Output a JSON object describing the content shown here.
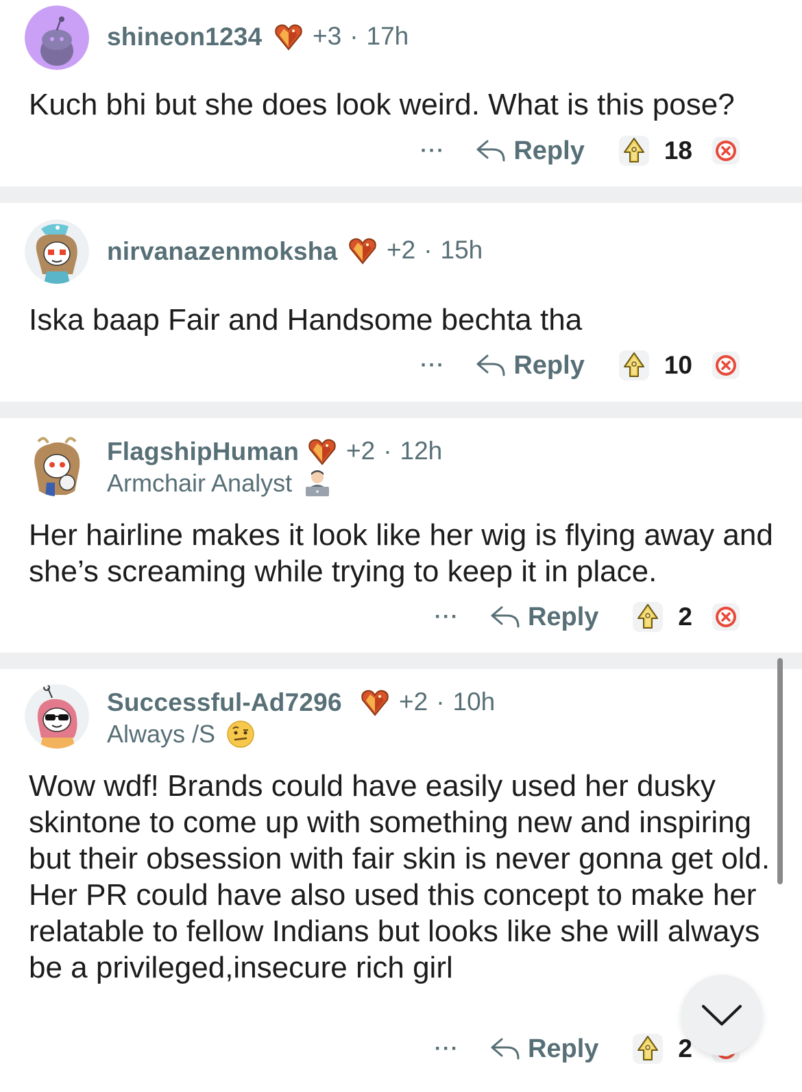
{
  "colors": {
    "meta_text": "#576f76",
    "body_text": "#1c1c1c",
    "separator": "#edeff1",
    "downvote": "#e84a3b",
    "upvote_gold": "#e8c23a"
  },
  "comments": [
    {
      "username": "shineon1234",
      "award_icon": "crystal-heart-award-icon",
      "award_count": "+3",
      "separator": "·",
      "age": "17h",
      "body": "Kuch bhi but she does look weird. What is this pose?",
      "more": "···",
      "reply": "Reply",
      "score": "18"
    },
    {
      "username": "nirvanazenmoksha",
      "award_icon": "crystal-heart-award-icon",
      "award_count": "+2",
      "separator": "·",
      "age": "15h",
      "body": "Iska baap Fair and Handsome bechta tha",
      "more": "···",
      "reply": "Reply",
      "score": "10"
    },
    {
      "username": "FlagshipHuman",
      "award_icon": "crystal-heart-award-icon",
      "award_count": "+2",
      "separator": "·",
      "age": "12h",
      "flair": "Armchair Analyst",
      "flair_emoji": "laptop-person-emoji-icon",
      "body": "Her hairline makes it look like her wig is flying away and she’s screaming while trying to keep it in place.",
      "more": "···",
      "reply": "Reply",
      "score": "2"
    },
    {
      "username": "Successful-Ad7296",
      "award_icon": "crystal-heart-award-icon",
      "award_count": "+2",
      "separator": "·",
      "age": "10h",
      "flair": "Always /S",
      "flair_emoji": "raised-eyebrow-emoji-icon",
      "body": "Wow wdf! Brands could have easily used her dusky skintone to come up with something new and inspiring but their obsession with fair skin is never gonna get old. Her PR could have also used this concept to make her relatable to fellow Indians but looks like she will always be a privileged,insecure rich girl",
      "more": "···",
      "reply": "Reply",
      "score": "2"
    }
  ],
  "scroll_button_icon": "chevron-down-icon"
}
